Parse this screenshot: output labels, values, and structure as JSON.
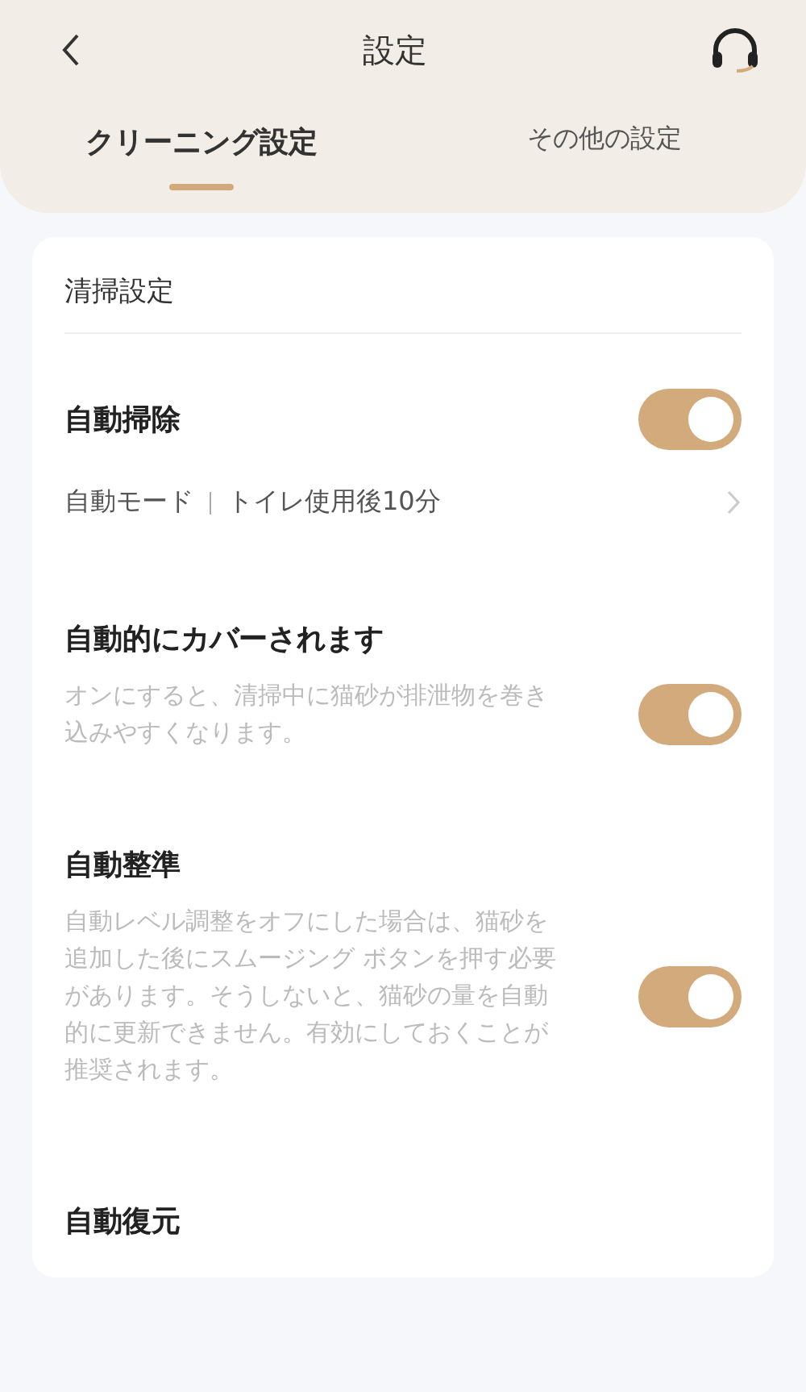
{
  "header": {
    "title": "設定"
  },
  "tabs": [
    {
      "label": "クリーニング設定",
      "selected": true
    },
    {
      "label": "その他の設定",
      "selected": false
    }
  ],
  "section": {
    "title": "清掃設定",
    "items": [
      {
        "kind": "switch",
        "title": "自動掃除",
        "on": true
      },
      {
        "kind": "link",
        "mode": "自動モード",
        "detail": "トイレ使用後10分"
      },
      {
        "kind": "switch",
        "title": "自動的にカバーされます",
        "description": "オンにすると、清掃中に猫砂が排泄物を巻き込みやすくなります。",
        "on": true
      },
      {
        "kind": "switch",
        "title": "自動整準",
        "description": "自動レベル調整をオフにした場合は、猫砂を追加した後にスムージング ボタンを押す必要があります。そうしないと、猫砂の量を自動的に更新できません。有効にしておくことが推奨されます。",
        "on": true
      },
      {
        "kind": "title",
        "title": "自動復元"
      }
    ]
  }
}
